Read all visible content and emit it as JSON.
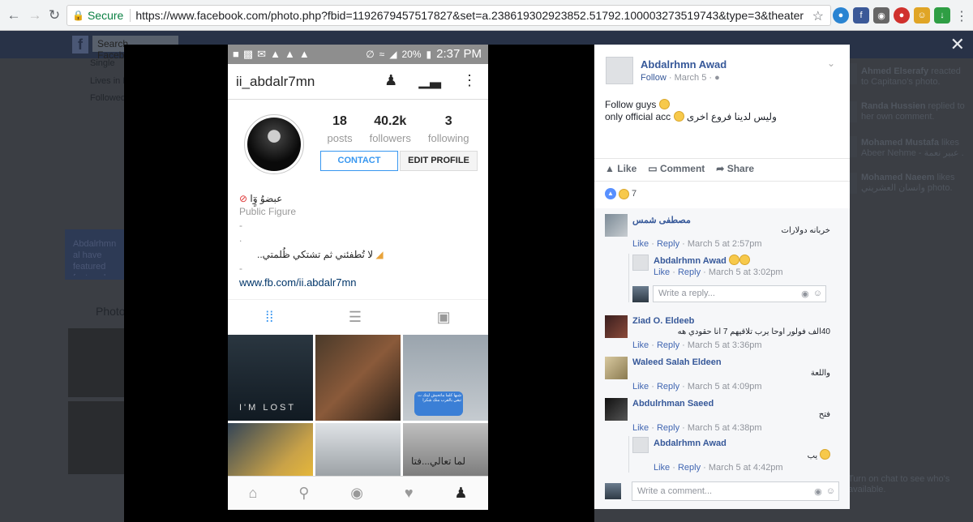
{
  "browser": {
    "secure_label": "Secure",
    "url": "https://www.facebook.com/photo.php?fbid=1192679457517827&set=a.238619302923852.51792.100003273519743&type=3&theater"
  },
  "fb_background": {
    "search_placeholder": "Search Facebook",
    "left_items": [
      "Single",
      "Lives in Lo",
      "Followed"
    ],
    "blue_box_text": "Abdalrhmn al have featured featured phot",
    "photos_label": "Photos",
    "ticker": [
      {
        "name": "Ahmed Elserafy",
        "text": "reacted to Capitano's photo."
      },
      {
        "name": "Randa Hussien",
        "text": "replied to her own comment."
      },
      {
        "name": "Mohamed Mustafa",
        "text": "likes Abeer Nehme - عبير نعمة ."
      },
      {
        "name": "Mohamed Naeem",
        "text": "likes وانسان العشريني photo."
      }
    ],
    "chat_text": "Turn on chat to see who's available."
  },
  "instagram": {
    "status": {
      "battery": "20%",
      "time": "2:37 PM"
    },
    "username": "ii_abdalr7mn",
    "stats": [
      {
        "num": "18",
        "label": "posts"
      },
      {
        "num": "40.2k",
        "label": "followers"
      },
      {
        "num": "3",
        "label": "following"
      }
    ],
    "contact_label": "CONTACT",
    "edit_label": "EDIT PROFILE",
    "bio_name": "عبضوُ وٍٓا",
    "category": "Public Figure",
    "bio_line": "لا تُطفئني ثم تشتكي ظُلمتي..",
    "link": "www.fb.com/ii.abdalr7mn",
    "grid_text": {
      "im_lost": "I'M LOST",
      "bubble": "شبها كلما ماتحبش ليتك ت تبقي بالقرب منك شكرا",
      "arabic_wall": "لما تعالي...فتا"
    }
  },
  "post": {
    "author": "Abdalrhmn Awad",
    "follow_label": "Follow",
    "date": "March 5",
    "text_line1": "Follow guys",
    "text_line2_en": "only official acc",
    "text_line2_ar": "وليس لدينا فروع اخرى",
    "actions": [
      "Like",
      "Comment",
      "Share"
    ],
    "reaction_count": "7"
  },
  "comments": [
    {
      "name": "مصطفى شمس",
      "text": "خربانه دولارات",
      "time": "March 5 at 2:57pm"
    },
    {
      "name": "Abdalrhmn Awad",
      "text": "",
      "time": "March 5 at 3:02pm",
      "reply": true
    },
    {
      "name": "Ziad O. Eldeeb",
      "text": "40الف فولور اوحا يرب تلاقيهم 7 انا حقودي هه",
      "time": "March 5 at 3:36pm"
    },
    {
      "name": "Waleed Salah Eldeen",
      "text": "واللعة",
      "time": "March 5 at 4:09pm"
    },
    {
      "name": "Abdulrhman Saeed",
      "text": "فتح",
      "time": "March 5 at 4:38pm"
    },
    {
      "name": "Abdalrhmn Awad",
      "text": "يب",
      "time": "March 5 at 4:42pm",
      "reply": true
    }
  ],
  "comment_actions": {
    "like": "Like",
    "reply": "Reply"
  },
  "reply_placeholder": "Write a reply...",
  "comment_placeholder": "Write a comment..."
}
